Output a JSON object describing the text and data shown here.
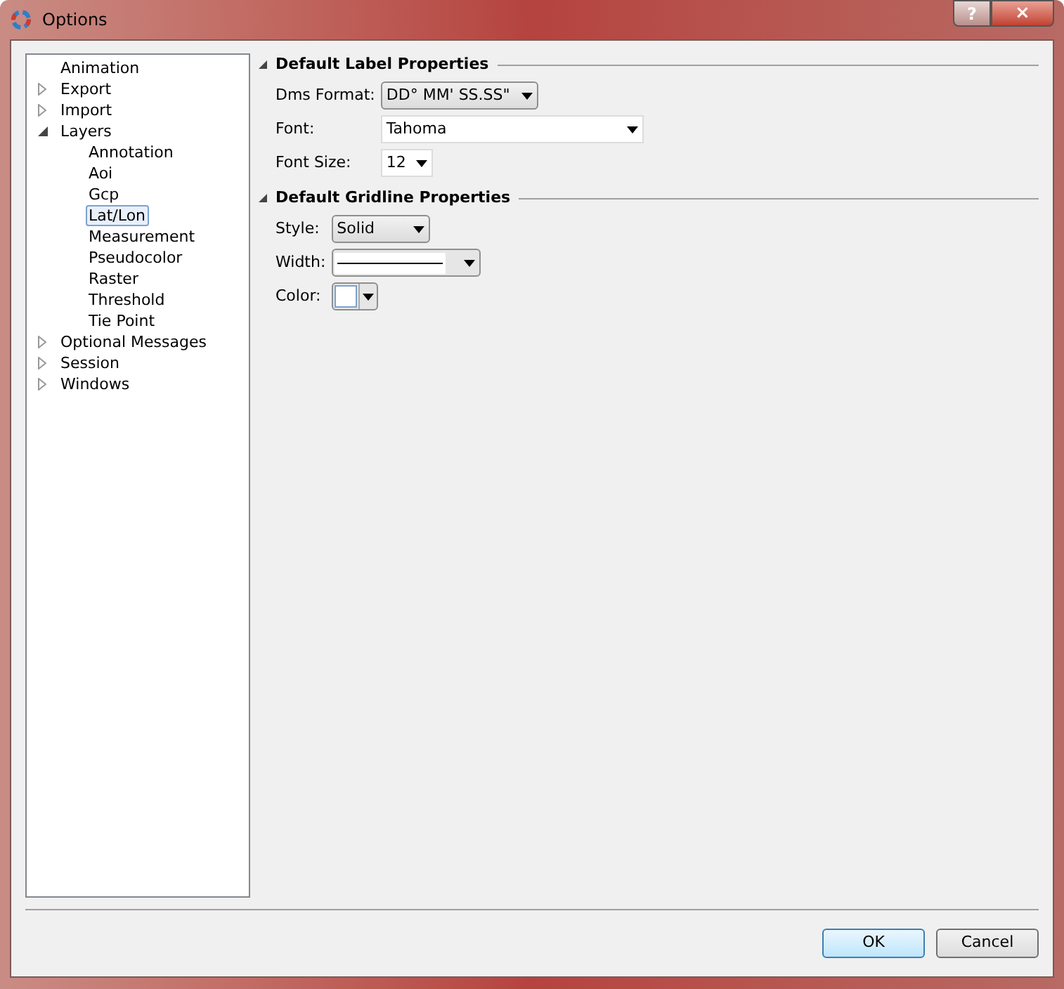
{
  "window": {
    "title": "Options",
    "help_button": "?",
    "close_button": "×"
  },
  "tree": [
    {
      "label": "Animation",
      "kind": "leaf",
      "selected": false
    },
    {
      "label": "Export",
      "kind": "group",
      "expanded": false,
      "selected": false
    },
    {
      "label": "Import",
      "kind": "group",
      "expanded": false,
      "selected": false
    },
    {
      "label": "Layers",
      "kind": "group",
      "expanded": true,
      "selected": false,
      "children": [
        {
          "label": "Annotation",
          "kind": "leaf",
          "selected": false
        },
        {
          "label": "Aoi",
          "kind": "leaf",
          "selected": false
        },
        {
          "label": "Gcp",
          "kind": "leaf",
          "selected": false
        },
        {
          "label": "Lat/Lon",
          "kind": "leaf",
          "selected": true
        },
        {
          "label": "Measurement",
          "kind": "leaf",
          "selected": false
        },
        {
          "label": "Pseudocolor",
          "kind": "leaf",
          "selected": false
        },
        {
          "label": "Raster",
          "kind": "leaf",
          "selected": false
        },
        {
          "label": "Threshold",
          "kind": "leaf",
          "selected": false
        },
        {
          "label": "Tie Point",
          "kind": "leaf",
          "selected": false
        }
      ]
    },
    {
      "label": "Optional Messages",
      "kind": "group",
      "expanded": false,
      "selected": false
    },
    {
      "label": "Session",
      "kind": "group",
      "expanded": false,
      "selected": false
    },
    {
      "label": "Windows",
      "kind": "group",
      "expanded": false,
      "selected": false
    }
  ],
  "sections": [
    {
      "title": "Default Label Properties",
      "expanded": true,
      "fields": [
        {
          "label": "Dms Format:",
          "kind": "dropdown",
          "value": "DD° MM' SS.SS\""
        },
        {
          "label": "Font:",
          "kind": "combo",
          "value": "Tahoma"
        },
        {
          "label": "Font Size:",
          "kind": "combo_small",
          "value": "12"
        }
      ]
    },
    {
      "title": "Default Gridline Properties",
      "expanded": true,
      "fields": [
        {
          "label": "Style:",
          "kind": "dropdown",
          "value": "Solid"
        },
        {
          "label": "Width:",
          "kind": "line"
        },
        {
          "label": "Color:",
          "kind": "color",
          "color": "#ffffff"
        }
      ]
    }
  ],
  "buttons": [
    {
      "label": "OK",
      "default": true
    },
    {
      "label": "Cancel",
      "default": false
    }
  ]
}
